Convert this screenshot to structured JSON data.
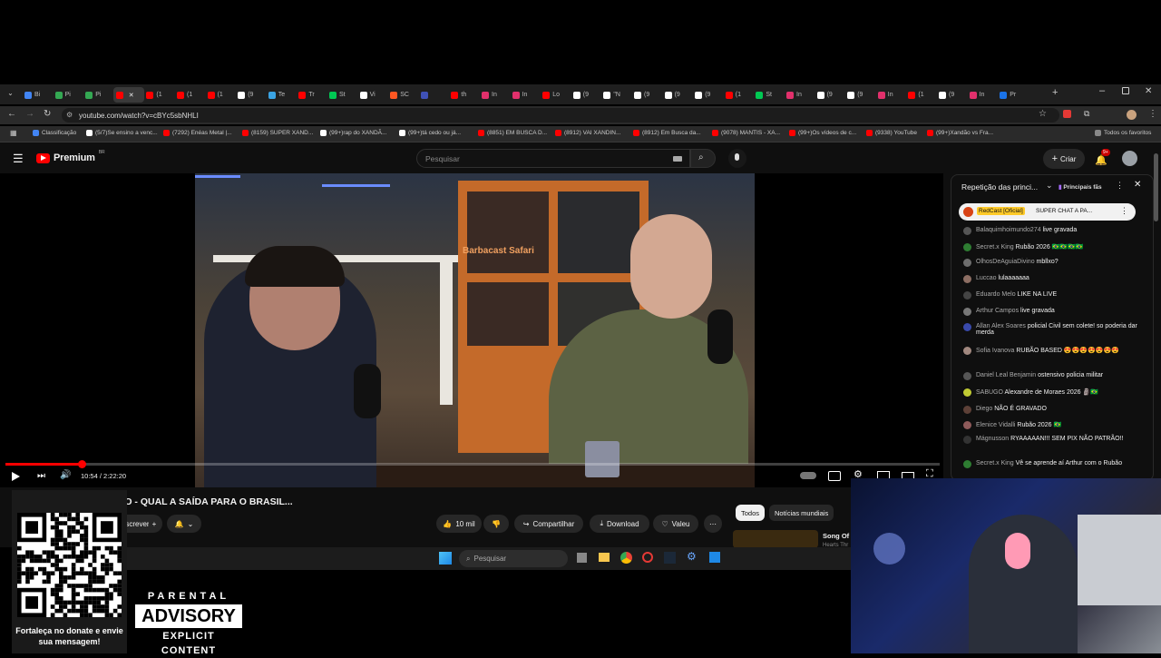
{
  "browser": {
    "tabs": [
      "Bi",
      "Pi",
      "Pi",
      "",
      "(1",
      "(1",
      "(1",
      "(9",
      "Te",
      "Tr",
      "St",
      "Vi",
      "SC",
      "",
      "th",
      "In",
      "In",
      "Lo",
      "(9",
      "\"N",
      "(9",
      "(9",
      "(9",
      "(1",
      "St",
      "In",
      "(9",
      "(9",
      "In",
      "(1",
      "(9",
      "In",
      "Pr"
    ],
    "url": "youtube.com/watch?v=cBYc5sbNHLI",
    "bookmarks": [
      "Classificação",
      "(5/7)Se ensino a venc...",
      "(7292) Enéas Metal |...",
      "(8159) SUPER XAND...",
      "(99+)rap do XANDÃ...",
      "(99+)tá cedo ou já...",
      "(8851) EM BUSCA D...",
      "(8912) VAI XANDIN...",
      "(8912) Em Busca da...",
      "(9078) MANTIS - XA...",
      "(99+)Os vídeos de c...",
      "(9338) YouTube",
      "(99+)Xandão vs Fra..."
    ],
    "all_favorites": "Todos os favoritos"
  },
  "youtube": {
    "logo": "Premium",
    "region": "BR",
    "search_placeholder": "Pesquisar",
    "create": "Criar",
    "notif_count": "9+",
    "time": "10:54 / 2:22:20",
    "progress": 0.082,
    "video_title": "pixgg.com/SUPERXANDO - QUAL A SAÍDA PARA O BRASIL...",
    "subscribe": "Inscrever-se",
    "likes": "10 mil",
    "share": "Compartilhar",
    "download": "Download",
    "thanks": "Valeu",
    "chips": [
      "Todos",
      "Notícias mundiais"
    ],
    "rec_title": "Song Of",
    "rec_sub": "Hearts Thr",
    "video_sign": "Barbacast Safari"
  },
  "chat": {
    "header": "Repetição das princi...",
    "filter": "Principais fãs",
    "pinned_author": "RedCast [Oficial]",
    "pinned_text": "SUPER CHAT A PA...",
    "messages": [
      {
        "author": "Balaquimhoimundo274",
        "text": "live gravada",
        "color": "#555"
      },
      {
        "author": "Secret.x King",
        "text": "Rubão 2026 🇧🇷🇧🇷🇧🇷🇧🇷",
        "color": "#2e7d32"
      },
      {
        "author": "OlhosDeAguiaDivino",
        "text": "mbllxo?",
        "color": "#6d6d6d"
      },
      {
        "author": "Luccao",
        "text": "lulaaaaaaa",
        "color": "#8d6e63"
      },
      {
        "author": "Eduardo Melo",
        "text": "LIKE NA LIVE",
        "color": "#444"
      },
      {
        "author": "Arthur Campos",
        "text": "live gravada",
        "color": "#777"
      },
      {
        "author": "Allan Alex Soares",
        "text": "policial Civil sem colete! so poderia dar merda",
        "color": "#3949ab"
      },
      {
        "author": "Sofia Ivanova",
        "text": "RUBÃO BASED 😍😍😍😍😍😍😍",
        "color": "#a1887f"
      },
      {
        "author": "Daniel Leal Benjamin",
        "text": "ostensivo policia militar",
        "color": "#555"
      },
      {
        "author": "SABUGO",
        "text": "Alexandre de Moraes 2026 🗿🇧🇷",
        "color": "#c0ca33"
      },
      {
        "author": "Diego",
        "text": "NÃO É GRAVADO",
        "color": "#5d4037"
      },
      {
        "author": "Elenice Vidalli",
        "text": "Rubão 2026 🇧🇷",
        "color": "#8e5a5a"
      },
      {
        "author": "Mágnusson",
        "text": "RYAAAAAN!!! SEM PIX NÃO PATRÃO!!",
        "color": "#333"
      },
      {
        "author": "Secret.x King",
        "text": "Vê se aprende aí Arthur com o Rubão",
        "color": "#2e7d32"
      }
    ]
  },
  "taskbar": {
    "search": "Pesquisar"
  },
  "overlay": {
    "donate_text": "Fortaleça no donate e envie sua mensagem!",
    "parental_1": "PARENTAL",
    "parental_2": "ADVISORY",
    "parental_3": "EXPLICIT CONTENT"
  },
  "colors": {
    "yt_red": "#ff0000",
    "chat_yellow": "#ffca28",
    "accent_blue": "#3ea6ff"
  }
}
